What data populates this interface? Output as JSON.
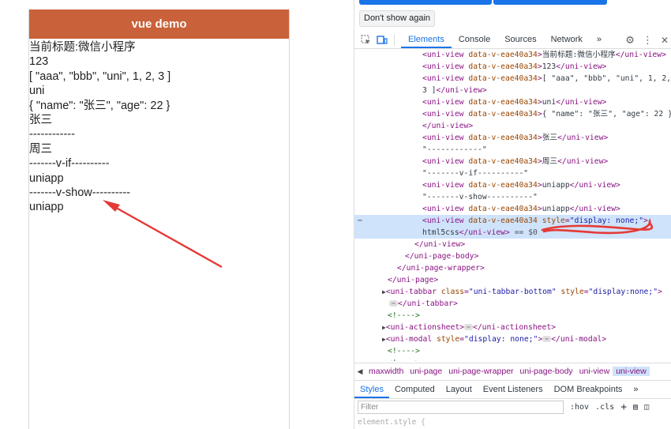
{
  "preview": {
    "nav_title": "vue demo",
    "lines": [
      "当前标题:微信小程序",
      "123",
      "[ \"aaa\", \"bbb\", \"uni\", 1, 2, 3 ]",
      "uni",
      "{ \"name\": \"张三\", \"age\": 22 }",
      "张三",
      "------------",
      "周三",
      "-------v-if----------",
      "uniapp",
      "-------v-show----------",
      "uniapp"
    ],
    "annotation_color": "#e53935"
  },
  "devtools": {
    "banner_button": "Don't show again",
    "tabs": [
      "Elements",
      "Console",
      "Sources",
      "Network"
    ],
    "active_tab": "Elements",
    "tree": {
      "tag_view": "uni-view",
      "attr_name": "data-v-eae40a34",
      "row0_text": "当前标题:微信小程序",
      "row1_text": "123",
      "row2_text": "[ \"aaa\", \"bbb\", \"uni\", 1, 2,",
      "row3_text": "3 ]",
      "row4_text": "uni",
      "row5_text": "{ \"name\": \"张三\", \"age\": 22 }",
      "row7_text": "张三",
      "row8_text": "\"------------\"",
      "row9_text": "周三",
      "row10_text": "\"-------v-if----------\"",
      "row11_text": "uniapp",
      "row12_text": "\"-------v-show----------\"",
      "row13_text": "uniapp",
      "row14_style_attr": "style",
      "row14_style_val": "\"display: none;\"",
      "row15_text": "html5css",
      "row15_suffix": "== $0",
      "close_view": "</uni-view>",
      "close_page_body": "</uni-page-body>",
      "close_page_wrapper": "</uni-page-wrapper>",
      "close_page": "</uni-page>",
      "tabbar_tag": "uni-tabbar",
      "tabbar_class_attr": "class",
      "tabbar_class_val": "\"uni-tabbar-bottom\"",
      "tabbar_style_attr": "style",
      "tabbar_style_val": "\"display:none;\"",
      "close_tabbar": "</uni-tabbar>",
      "comment": "<!---->",
      "actionsheet_tag": "uni-actionsheet",
      "close_actionsheet": "</uni-actionsheet>",
      "modal_tag": "uni-modal",
      "modal_style_attr": "style",
      "modal_style_val": "\"display: none;\"",
      "close_modal": "</uni-modal>"
    },
    "breadcrumbs": [
      "maxwidth",
      "uni-page",
      "uni-page-wrapper",
      "uni-page-body",
      "uni-view",
      "uni-view"
    ],
    "subtabs": [
      "Styles",
      "Computed",
      "Layout",
      "Event Listeners",
      "DOM Breakpoints"
    ],
    "active_subtab": "Styles",
    "filter_placeholder": "Filter",
    "hov_label": ":hov",
    "cls_label": ".cls",
    "element_style": "element.style {",
    "annotation_color": "#e53935"
  }
}
